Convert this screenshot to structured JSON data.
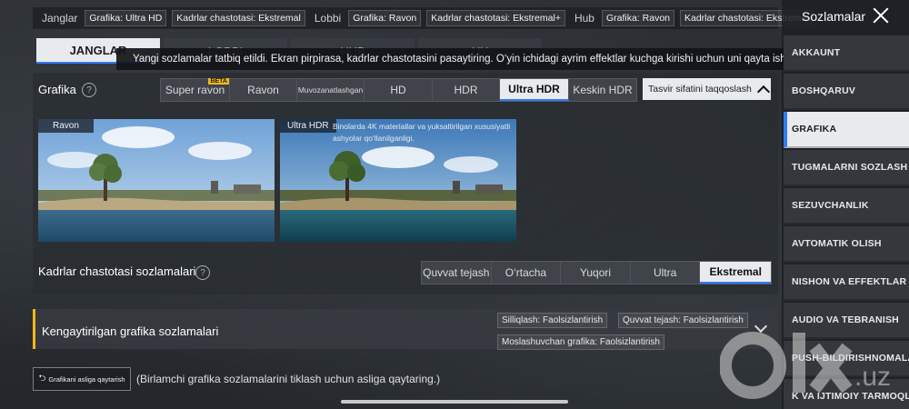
{
  "topbar": {
    "groups": [
      {
        "name": "Janglar",
        "chips": [
          "Grafika: Ultra HD",
          "Kadrlar chastotasi: Ekstremal"
        ]
      },
      {
        "name": "Lobbi",
        "chips": [
          "Grafika: Ravon",
          "Kadrlar chastotasi: Ekstremal+"
        ]
      },
      {
        "name": "Hub",
        "chips": [
          "Grafika: Ravon",
          "Kadrlar chastotasi: Ekstremal"
        ]
      }
    ]
  },
  "sidebar": {
    "title": "Sozlamalar",
    "items": [
      {
        "label": "AKKAUNT",
        "active": false
      },
      {
        "label": "BOSHQARUV",
        "active": false
      },
      {
        "label": "GRAFIKA",
        "active": true
      },
      {
        "label": "TUGMALARNI SOZLASH",
        "active": false
      },
      {
        "label": "SEZUVCHANLIK",
        "active": false
      },
      {
        "label": "AVTOMATIK OLISH",
        "active": false
      },
      {
        "label": "NISHON VA EFFEKTLAR",
        "active": false
      },
      {
        "label": "AUDIO VA TEBRANISH",
        "active": false
      },
      {
        "label": "PUSH-BILDIRISHNOMALAR",
        "active": false
      },
      {
        "label": "K VA IJTIMOIY TARMOQLAR",
        "active": false
      }
    ]
  },
  "tabs": [
    {
      "label": "JANGLAR",
      "active": true
    },
    {
      "label": "LOBBI",
      "active": false
    },
    {
      "label": "HUB",
      "active": false
    },
    {
      "label": "UY",
      "active": false
    }
  ],
  "toast": "Yangi sozlamalar tatbiq etildi. Ekran pirpirasa, kadrlar chastotasini pasaytiring. O‘yin ichidagi ayrim effektlar kuchga kirishi uchun uni qayta ishg",
  "graphics": {
    "label": "Grafika",
    "options": [
      "Super ravon",
      "Ravon",
      "Muvozanatlashgan",
      "HD",
      "HDR",
      "Ultra HDR",
      "Keskin HDR"
    ],
    "beta_badge": "BETA",
    "selected": "Ultra HDR",
    "compare_label": "Tasvir sifatini taqqoslash"
  },
  "previews": [
    {
      "label": "Ravon",
      "desc": ""
    },
    {
      "label": "Ultra HDR",
      "desc": "Binolarda 4K materiallar va yuksaltirilgan xususiyatli ashyolar qo‘llanilganligi."
    }
  ],
  "fps": {
    "label": "Kadrlar chastotasi sozlamalari",
    "options": [
      "Quvvat tejash",
      "O‘rtacha",
      "Yuqori",
      "Ultra",
      "Ekstremal"
    ],
    "selected": "Ekstremal"
  },
  "advanced": {
    "title": "Kengaytirilgan grafika sozlamalari",
    "chips": [
      "Silliqlash: Faolsizlantirish",
      "Quvvat tejash: Faolsizlantirish",
      "Moslashuvchan grafika: Faolsizlantirish"
    ]
  },
  "reset": {
    "button_label": "Grafikani asliga qaytarish",
    "note": "(Birlamchi grafika sozlamalarini tiklash uchun asliga qaytaring.)"
  },
  "watermark": "olx.uz",
  "colors": {
    "accent": "#2f7cf6",
    "beta": "#f2b71a",
    "selected_bg": "#e8eaee"
  }
}
